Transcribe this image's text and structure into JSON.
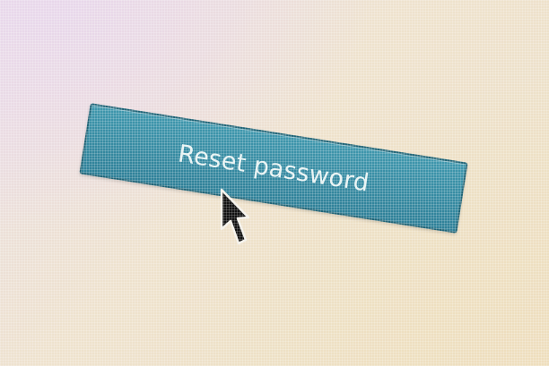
{
  "button": {
    "label": "Reset password",
    "color": "#3a8ea5",
    "border_color": "#1f6477",
    "text_color": "#e8f3f3"
  },
  "cursor": {
    "icon": "arrow-pointer-icon"
  }
}
